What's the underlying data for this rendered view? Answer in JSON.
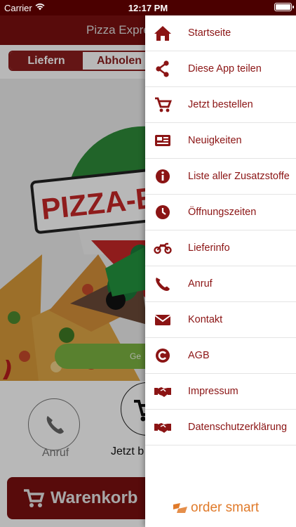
{
  "status_bar": {
    "carrier": "Carrier",
    "time": "12:17 PM"
  },
  "app": {
    "title": "Pizza Expre",
    "tabs": [
      {
        "label": "Liefern"
      },
      {
        "label": "Abholen"
      }
    ],
    "status_pill": "Ge",
    "actions": [
      {
        "label": "Anruf"
      },
      {
        "label": "Jetzt b"
      }
    ],
    "cart_label": "Warenkorb",
    "logo_text": "PIZZA-E"
  },
  "drawer": {
    "items": [
      {
        "label": "Startseite",
        "icon": "home-icon"
      },
      {
        "label": "Diese App teilen",
        "icon": "share-icon"
      },
      {
        "label": "Jetzt bestellen",
        "icon": "cart-icon"
      },
      {
        "label": "Neuigkeiten",
        "icon": "newspaper-icon"
      },
      {
        "label": "Liste aller Zusatzstoffe",
        "icon": "info-icon"
      },
      {
        "label": "Öffnungszeiten",
        "icon": "clock-icon"
      },
      {
        "label": "Lieferinfo",
        "icon": "motorcycle-icon"
      },
      {
        "label": "Anruf",
        "icon": "phone-icon"
      },
      {
        "label": "Kontakt",
        "icon": "envelope-icon"
      },
      {
        "label": "AGB",
        "icon": "copyright-icon"
      },
      {
        "label": "Impressum",
        "icon": "handshake-icon"
      },
      {
        "label": "Datenschutzerklärung",
        "icon": "handshake-icon"
      }
    ],
    "brand": "order smart"
  },
  "colors": {
    "brand_red": "#7a1010",
    "menu_text": "#8b1414",
    "accent_orange": "#e07a2a",
    "status_green": "#7cb342"
  }
}
